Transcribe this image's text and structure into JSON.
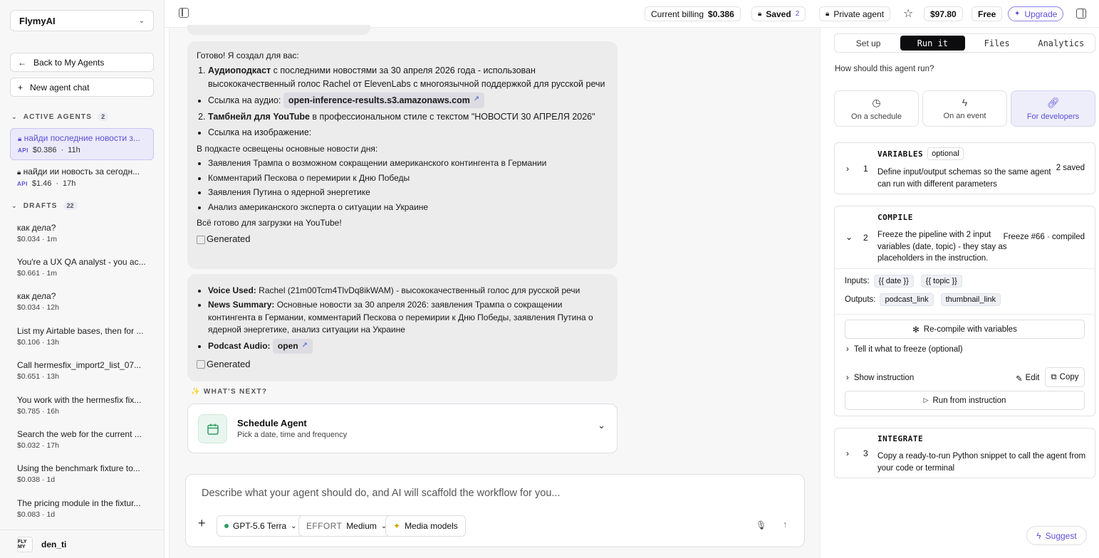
{
  "workspace": {
    "name": "FlymyAI"
  },
  "sidebar": {
    "back_label": "Back to My Agents",
    "new_chat_label": "New agent chat",
    "active_header": "ACTIVE AGENTS",
    "active_count": "2",
    "active_agents": [
      {
        "title": "найди последние новости з...",
        "tag": "API",
        "cost": "$0.386",
        "time": "11h"
      },
      {
        "title": "найди ии новость за сегодн...",
        "tag": "API",
        "cost": "$1.46",
        "time": "17h"
      }
    ],
    "drafts_header": "DRAFTS",
    "drafts_count": "22",
    "drafts": [
      {
        "title": "как дела?",
        "cost": "$0.034",
        "time": "1m"
      },
      {
        "title": "You're a UX QA analyst - you ac...",
        "cost": "$0.661",
        "time": "1m"
      },
      {
        "title": "как дела?",
        "cost": "$0.034",
        "time": "12h"
      },
      {
        "title": "List my Airtable bases, then for ...",
        "cost": "$0.106",
        "time": "13h"
      },
      {
        "title": "Call hermesfix_import2_list_07...",
        "cost": "$0.651",
        "time": "13h"
      },
      {
        "title": "You work with the hermesfix fix...",
        "cost": "$0.785",
        "time": "16h"
      },
      {
        "title": "Search the web for the current ...",
        "cost": "$0.032",
        "time": "17h"
      },
      {
        "title": "Using the benchmark fixture to...",
        "cost": "$0.038",
        "time": "1d"
      },
      {
        "title": "The pricing module in the fixtur...",
        "cost": "$0.083",
        "time": "1d"
      }
    ],
    "user": {
      "name": "den_ti",
      "avatar_text": "FLY MY"
    }
  },
  "topbar": {
    "billing_label": "Current billing",
    "billing_value": "$0.386",
    "saved_label": "Saved",
    "saved_count": "2",
    "private_label": "Private agent",
    "balance": "$97.80",
    "plan": "Free",
    "upgrade_label": "Upgrade"
  },
  "chat": {
    "msg1": {
      "intro": "Готово! Я создал для вас:",
      "item1_bold": "Аудиоподкаст",
      "item1_text": " с последними новостями за 30 апреля 2026 года - использован высококачественный голос Rachel от ElevenLabs с многоязычной поддержкой для русской речи",
      "audio_label": "Ссылка на аудио:",
      "audio_link": "open-inference-results.s3.amazonaws.com",
      "item2_bold": "Тамбнейл для YouTube",
      "item2_text": " в профессиональном стиле с текстом \"НОВОСТИ 30 АПРЕЛЯ 2026\"",
      "image_label": "Ссылка на изображение:",
      "covered": "В подкасте освещены основные новости дня:",
      "news": [
        "Заявления Трампа о возможном сокращении американского контингента в Германии",
        "Комментарий Пескова о перемирии к Дню Победы",
        "Заявления Путина о ядерной энергетике",
        "Анализ американского эксперта о ситуации на Украине"
      ],
      "done": "Всё готово для загрузки на YouTube!",
      "image_alt": "Generated"
    },
    "msg2": {
      "voice_label": "Voice Used:",
      "voice_text": " Rachel (21m00Tcm4TlvDq8ikWAM) - высококачественный голос для русской речи",
      "summary_label": "News Summary:",
      "summary_text": " Основные новости за 30 апреля 2026: заявления Трампа о сокращении контингента в Германии, комментарий Пескова о перемирии к Дню Победы, заявления Путина о ядерной энергетике, анализ ситуации на Украине",
      "podcast_label": "Podcast Audio:",
      "podcast_link": "open",
      "image_alt": "Generated"
    },
    "whats_next": "WHAT'S NEXT?",
    "schedule": {
      "title": "Schedule Agent",
      "subtitle": "Pick a date, time and frequency"
    },
    "composer": {
      "placeholder": "Describe what your agent should do, and AI will scaffold the workflow for you...",
      "model": "GPT-5.6 Terra",
      "effort_label": "EFFORT",
      "effort_value": "Medium",
      "media_label": "Media models"
    }
  },
  "right": {
    "tabs": [
      "Set up",
      "Run it",
      "Files",
      "Analytics"
    ],
    "question": "How should this agent run?",
    "modes": [
      "On a schedule",
      "On an event",
      "For developers"
    ],
    "variables": {
      "num": "1",
      "title": "VARIABLES",
      "badge": "optional",
      "desc": "Define input/output schemas so the same agent can run with different parameters",
      "status": "2 saved"
    },
    "compile": {
      "num": "2",
      "title": "COMPILE",
      "desc": "Freeze the pipeline with 2 input variables (date, topic) - they stay as placeholders in the instruction.",
      "status": "Freeze #66 · compiled",
      "inputs_label": "Inputs:",
      "inputs": [
        "{{ date }}",
        "{{ topic }}"
      ],
      "outputs_label": "Outputs:",
      "outputs": [
        "podcast_link",
        "thumbnail_link"
      ],
      "recompile_label": "Re-compile with variables",
      "freeze_hint": "Tell it what to freeze (optional)",
      "show_instruction": "Show instruction",
      "edit_label": "Edit",
      "copy_label": "Copy",
      "run_label": "Run from instruction"
    },
    "integrate": {
      "num": "3",
      "title": "INTEGRATE",
      "desc": "Copy a ready-to-run Python snippet to call the agent from your code or terminal"
    },
    "suggest_label": "Suggest"
  },
  "colors": {
    "accent": "#5b4fd6",
    "dark": "#0c0c0e",
    "green": "#2e9e63"
  }
}
